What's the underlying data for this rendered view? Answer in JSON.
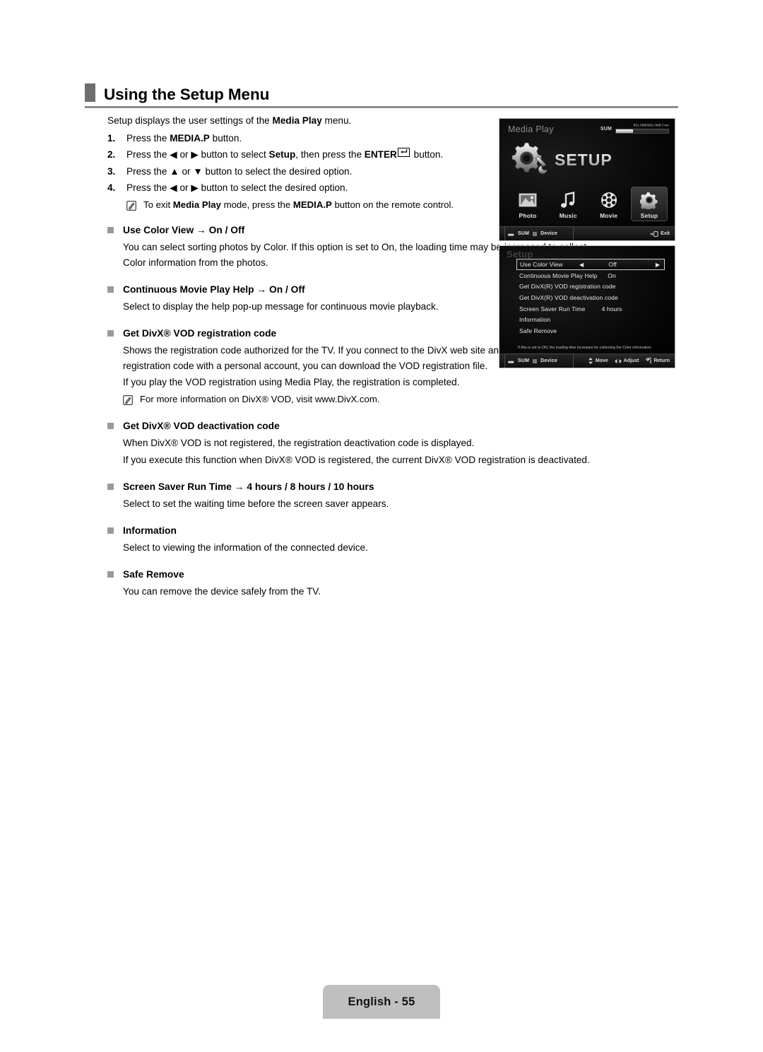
{
  "header": {
    "title": "Using the Setup Menu"
  },
  "intro": {
    "lead_1": "Setup displays the user settings of the ",
    "lead_bold": "Media Play",
    "lead_2": " menu."
  },
  "steps": [
    {
      "num": "1.",
      "parts": [
        {
          "t": "Press the ",
          "b": false
        },
        {
          "t": "MEDIA.P",
          "b": true
        },
        {
          "t": " button.",
          "b": false
        }
      ]
    },
    {
      "num": "2.",
      "parts": [
        {
          "t": "Press the ",
          "b": false
        },
        {
          "t": "◀",
          "b": false
        },
        {
          "t": " or ",
          "b": false
        },
        {
          "t": "▶",
          "b": false
        },
        {
          "t": " button to select ",
          "b": false
        },
        {
          "t": "Setup",
          "b": true
        },
        {
          "t": ", then press the ",
          "b": false
        },
        {
          "t": "ENTER",
          "b": true
        },
        {
          "t": "ENTERKEY",
          "b": false
        },
        {
          "t": " button.",
          "b": false
        }
      ]
    },
    {
      "num": "3.",
      "parts": [
        {
          "t": "Press the ",
          "b": false
        },
        {
          "t": "▲",
          "b": false
        },
        {
          "t": " or ",
          "b": false
        },
        {
          "t": "▼",
          "b": false
        },
        {
          "t": " button to select the desired option.",
          "b": false
        }
      ]
    },
    {
      "num": "4.",
      "parts": [
        {
          "t": "Press the ",
          "b": false
        },
        {
          "t": "◀",
          "b": false
        },
        {
          "t": " or ",
          "b": false
        },
        {
          "t": "▶",
          "b": false
        },
        {
          "t": " button to select the desired option.",
          "b": false
        }
      ]
    }
  ],
  "step_note": {
    "icon": "note-pencil-icon",
    "parts": [
      {
        "t": "To exit ",
        "b": false
      },
      {
        "t": "Media Play",
        "b": true
      },
      {
        "t": " mode, press the ",
        "b": false
      },
      {
        "t": "MEDIA.P",
        "b": true
      },
      {
        "t": " button on the remote control.",
        "b": false
      }
    ]
  },
  "sections": [
    {
      "id": "use-color-view",
      "title": "Use Color View → On / Off",
      "body": [
        "You can select sorting photos by Color. If this option is set to On, the loading time may be increased to collect Color information from the photos."
      ],
      "note": null
    },
    {
      "id": "continuous-movie-play-help",
      "title": "Continuous Movie Play Help → On / Off",
      "body": [
        "Select to display the help pop-up message for continuous movie playback."
      ],
      "note": null
    },
    {
      "id": "get-divx-vod-registration-code",
      "title": "Get DivX® VOD registration code",
      "body": [
        "Shows the registration code authorized for the TV. If you connect to the DivX web site and register the registration code with a personal account, you can download the VOD registration file.",
        "If you play the VOD registration using Media Play, the registration is completed."
      ],
      "note": "For more information on DivX® VOD, visit www.DivX.com."
    },
    {
      "id": "get-divx-vod-deactivation-code",
      "title": "Get DivX® VOD deactivation code",
      "body": [
        "When DivX® VOD is not registered, the registration deactivation code is displayed.",
        "If you execute this function when DivX® VOD is registered, the current DivX® VOD registration is deactivated."
      ],
      "note": null
    },
    {
      "id": "screen-saver-run-time",
      "title": "Screen Saver Run Time → 4 hours / 8 hours / 10 hours",
      "body": [
        "Select to set the waiting time before the screen saver appears."
      ],
      "note": null
    },
    {
      "id": "information",
      "title": "Information",
      "body": [
        "Select to viewing the information of the connected device."
      ],
      "note": null
    },
    {
      "id": "safe-remove",
      "title": "Safe Remove",
      "body": [
        "You can remove the device safely from the TV."
      ],
      "note": null
    }
  ],
  "tv_media_play": {
    "title": "Media Play",
    "sum_label": "SUM",
    "capacity_text": "851.0MB/962.0MB Free",
    "hero_label": "SETUP",
    "hero_icon": "gear-wrench-icon",
    "items": [
      {
        "label": "Photo",
        "icon": "photo-icon",
        "selected": false
      },
      {
        "label": "Music",
        "icon": "music-note-icon",
        "selected": false
      },
      {
        "label": "Movie",
        "icon": "film-reel-icon",
        "selected": false
      },
      {
        "label": "Setup",
        "icon": "gear-icon",
        "selected": true
      }
    ],
    "bottom_bar": {
      "source_label": "SUM",
      "device_label": "Device",
      "actions": [
        {
          "label": "Exit",
          "icon": "exit-icon"
        }
      ]
    }
  },
  "tv_setup": {
    "title": "Setup",
    "rows": [
      {
        "label": "Use Color View",
        "value": "Off",
        "selected": true,
        "arrows": true
      },
      {
        "label": "Continuous Movie Play Help",
        "value": "On",
        "selected": false,
        "arrows": false
      },
      {
        "label": "Get DivX(R) VOD registration code",
        "value": "",
        "selected": false,
        "arrows": false
      },
      {
        "label": "Get DivX(R) VOD deactivation code",
        "value": "",
        "selected": false,
        "arrows": false
      },
      {
        "label": "Screen Saver Run Time",
        "value": "4 hours",
        "selected": false,
        "arrows": false
      },
      {
        "label": "Information",
        "value": "",
        "selected": false,
        "arrows": false
      },
      {
        "label": "Safe Remove",
        "value": "",
        "selected": false,
        "arrows": false
      }
    ],
    "help_text": "If this is set to ON, the loading time increases for collecting the Color information.",
    "bottom_bar": {
      "source_label": "SUM",
      "device_label": "Device",
      "actions": [
        {
          "label": "Move",
          "icon": "updown-arrows-icon"
        },
        {
          "label": "Adjust",
          "icon": "leftright-arrows-icon"
        },
        {
          "label": "Return",
          "icon": "return-arrow-icon"
        }
      ]
    }
  },
  "footer": {
    "text": "English - 55"
  },
  "colors": {
    "header_marker": "#6e6e6e",
    "header_rule": "#8c8c8c",
    "bullet": "#9a9a9a",
    "footer_tab": "#bfbfbf"
  }
}
